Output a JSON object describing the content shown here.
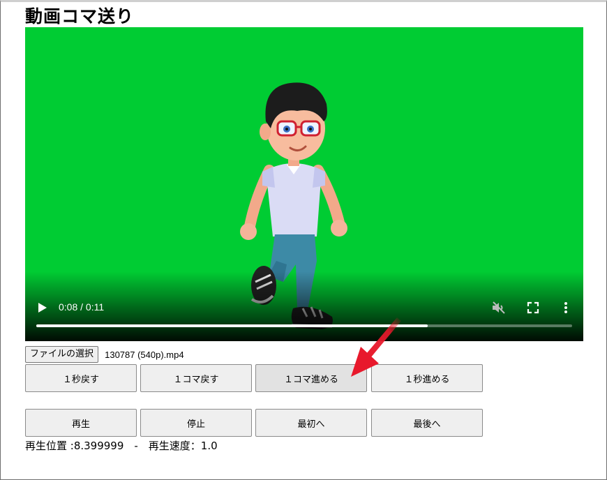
{
  "page": {
    "title": "動画コマ送り"
  },
  "video": {
    "time_label": "0:08 / 0:11",
    "progress": 0.73,
    "background_color": "#00cc33",
    "controls": {
      "play_icon": "play-icon",
      "volume_icon": "volume-muted-icon",
      "fullscreen_icon": "fullscreen-icon",
      "menu_icon": "more-vert-icon"
    }
  },
  "file": {
    "button_label": "ファイルの選択",
    "file_name": "130787 (540p).mp4"
  },
  "buttons_row1": [
    {
      "label": "１秒戻す"
    },
    {
      "label": "１コマ戻す"
    },
    {
      "label": "１コマ進める"
    },
    {
      "label": "１秒進める"
    }
  ],
  "buttons_row2": [
    {
      "label": "再生"
    },
    {
      "label": "停止"
    },
    {
      "label": "最初へ"
    },
    {
      "label": "最後へ"
    }
  ],
  "status": {
    "text": "再生位置 :8.399999　-　再生速度：1.0"
  },
  "annotation": {
    "arrow_color": "#e8192c"
  }
}
